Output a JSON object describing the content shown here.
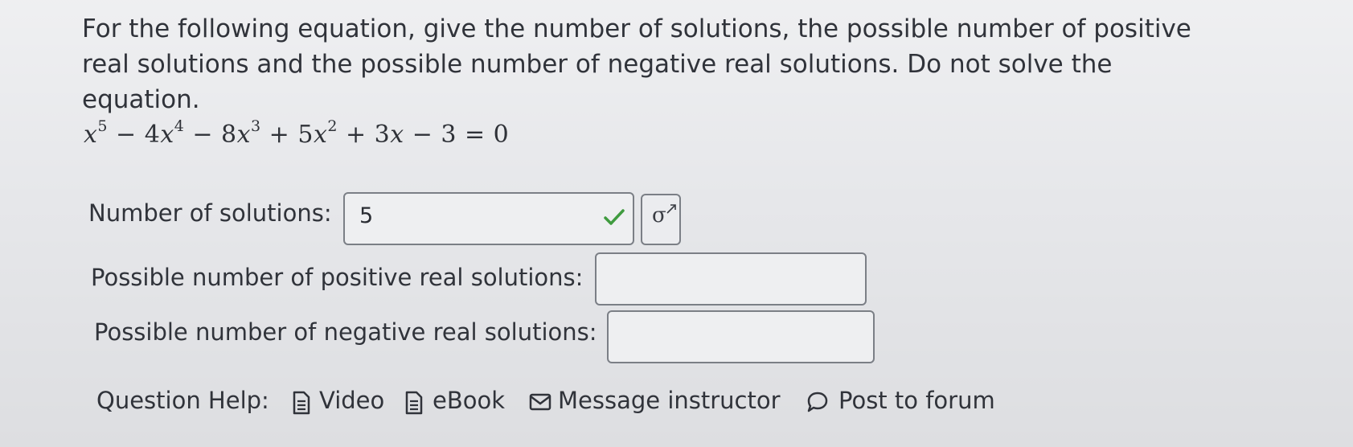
{
  "question": {
    "prompt": "For the following equation, give the number of solutions, the possible number of positive real solutions and the possible number of negative real solutions. Do not solve the equation."
  },
  "equation": {
    "t1": "x",
    "e1": "5",
    "op1": " − 4",
    "t2": "x",
    "e2": "4",
    "op2": " − 8",
    "t3": "x",
    "e3": "3",
    "op3": " + 5",
    "t4": "x",
    "e4": "2",
    "op4": " + 3",
    "t5": "x",
    "tail": " − 3 = 0"
  },
  "fields": {
    "solutions": {
      "label": "Number of solutions:",
      "value": "5"
    },
    "positive": {
      "label": "Possible number of positive real solutions:",
      "value": ""
    },
    "negative": {
      "label": "Possible number of negative real solutions:",
      "value": ""
    }
  },
  "preview_symbol": "σ",
  "help": {
    "label": "Question Help:",
    "video": "Video",
    "ebook": "eBook",
    "message": "Message instructor",
    "forum": "Post to forum"
  },
  "icons": [
    "check-icon",
    "document-icon",
    "envelope-icon",
    "speech-bubble-icon"
  ],
  "colors": {
    "check": "#3f9b3f",
    "border": "#7b7f86",
    "text": "#30333a"
  }
}
